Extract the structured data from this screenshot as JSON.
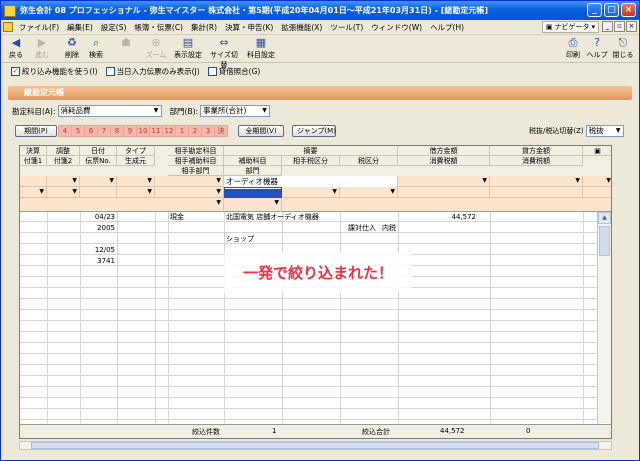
{
  "window": {
    "title": "弥生会計 08 プロフェッショナル - 弥生マイスター 株式会社・第5期(平成20年04月01日～平成21年03月31日) - [総勘定元帳]",
    "controls": [
      "_",
      "□",
      "×"
    ]
  },
  "menu": {
    "items": [
      "ファイル(F)",
      "編集(E)",
      "設定(S)",
      "帳簿・伝票(C)",
      "集計(R)",
      "決算・申告(K)",
      "拡張機能(X)",
      "ツール(T)",
      "ウィンドウ(W)",
      "ヘルプ(H)"
    ],
    "navi": "ナビゲータ",
    "mdi_controls": [
      "_",
      "▫",
      "×"
    ]
  },
  "toolbar": {
    "back": "戻る",
    "forward": "進む",
    "delete": "削除",
    "search": "検索",
    "btn4": "",
    "zoom": "ズーム",
    "display_settings": "表示設定",
    "size_switch": "サイズ切替",
    "account_settings": "科目設定",
    "print": "印刷",
    "help": "ヘルプ",
    "close": "閉じる"
  },
  "options": {
    "filter": "絞り込み機能を使う(I)",
    "filter_checked": true,
    "today_only": "当日入力伝票のみ表示(J)",
    "balance_match": "貸借照合(G)"
  },
  "panel": {
    "title": "総勘定元帳"
  },
  "filters": {
    "account_label": "勘定科目(A):",
    "account_value": "消耗品費",
    "dept_label": "部門(B):",
    "dept_value": "事業所(合計)",
    "period_button": "期間(P)",
    "months": [
      "4",
      "5",
      "6",
      "7",
      "8",
      "9",
      "10",
      "11",
      "12",
      "1",
      "2",
      "3",
      "決"
    ],
    "all_period_button": "全期間(V)",
    "jump_button": "ジャンプ(M)",
    "tax_label": "税抜/税込切替(Z)",
    "tax_value": "税抜"
  },
  "grid": {
    "headers_row1": [
      "決算",
      "調整",
      "日付",
      "タイプ",
      "相手勘定科目",
      "摘要",
      "借方金額",
      "貸方金額"
    ],
    "headers_row2": [
      "付箋1",
      "付箋2",
      "伝票No.",
      "生成元",
      "相手補助科目",
      "補助科目",
      "相手税区分",
      "税区分",
      "消費税額",
      "消費税額"
    ],
    "headers_row3": [
      "相手部門",
      "部門"
    ],
    "filter_text": "オーディオ機器",
    "rows": [
      {
        "date": "04/23",
        "account": "現金",
        "summary": "北国電気  店舗オーディオ機器",
        "debit": "44,572"
      },
      {
        "slip": "2005",
        "tax_partner": "課対仕入",
        "tax": "内税"
      },
      {
        "sub": "ショップ"
      },
      {
        "date": "12/05"
      },
      {
        "slip": "3741"
      }
    ],
    "footer": {
      "count_label": "絞込件数",
      "count_value": "1",
      "total_label": "絞込合計",
      "debit_total": "44,572",
      "credit_total": "0"
    }
  },
  "overlay": {
    "text": "一発で絞り込まれた！"
  },
  "colors": {
    "panel": "#e39657",
    "filter_row": "#fce4cf",
    "month_btn": "#f7b7ab",
    "overlay_text": "#f03040"
  }
}
